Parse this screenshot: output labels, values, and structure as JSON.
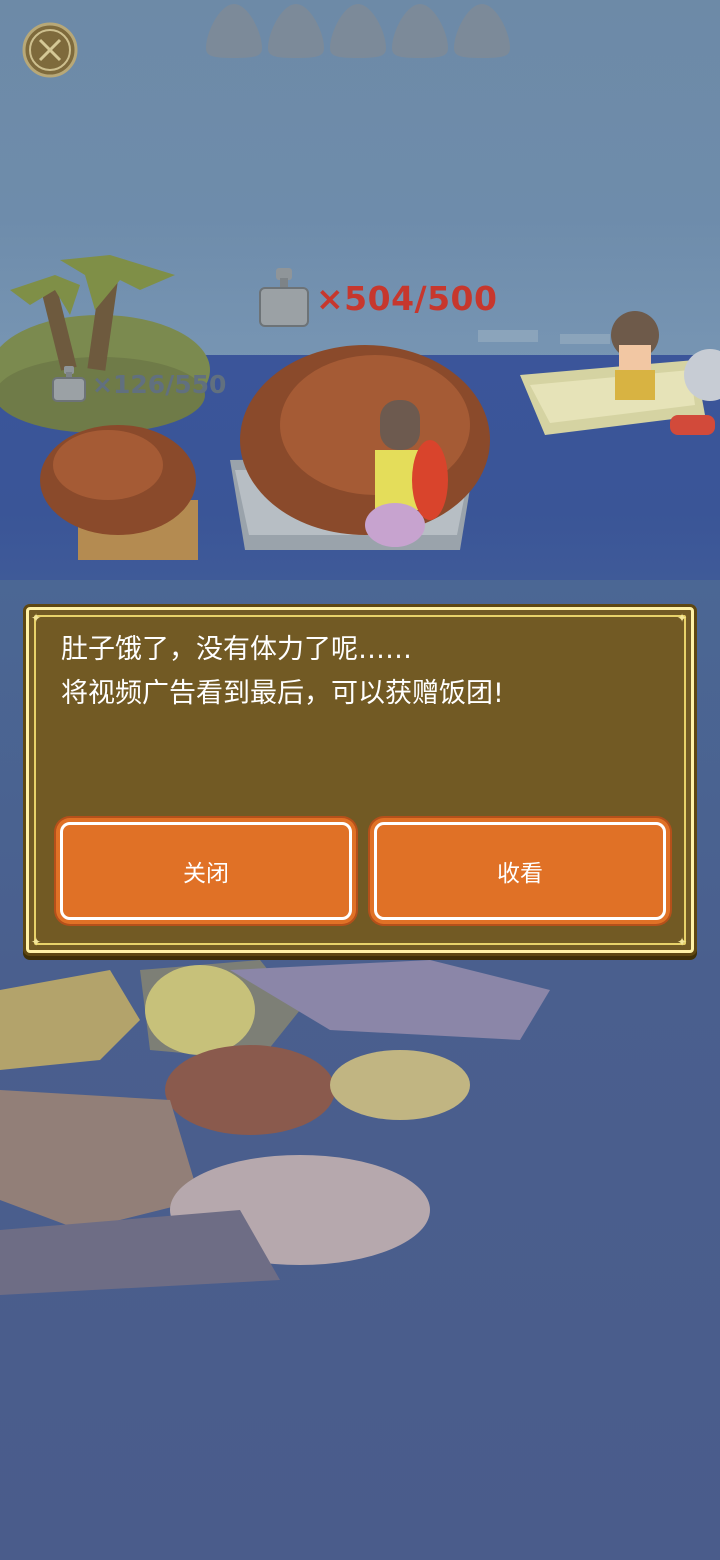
{
  "hud": {
    "close_icon": "close-circle-icon",
    "stamina_icon": "onigiri-icon",
    "stamina_slots": 5
  },
  "counters": {
    "boat_catch": "×504/500",
    "island_catch": "×126/550",
    "icon": "weight-icon"
  },
  "dialog": {
    "line1": "肚子饿了，没有体力了呢……",
    "line2": "将视频广告看到最后，可以获赠饭团!",
    "close_label": "关闭",
    "watch_label": "收看"
  },
  "colors": {
    "dialog_bg": "#725a24",
    "dialog_border": "#fff2a6",
    "button": "#e07126",
    "counter_main": "#c7372d",
    "counter_island": "#61707f"
  }
}
